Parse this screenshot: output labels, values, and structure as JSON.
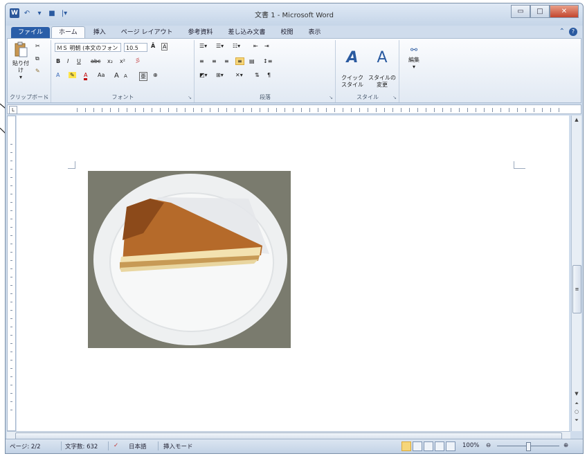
{
  "window": {
    "title": "文書 1 - Microsoft Word",
    "controls": {
      "minimize": "▭",
      "maximize": "□",
      "close": "✕"
    }
  },
  "quick_access": {
    "undo": "↶",
    "redo": "▾",
    "save": "■",
    "customize": "|▾"
  },
  "tabs": [
    {
      "label": "ファイル",
      "active": false,
      "file": true
    },
    {
      "label": "ホーム",
      "active": true,
      "file": false
    },
    {
      "label": "挿入",
      "active": false,
      "file": false
    },
    {
      "label": "ページ レイアウト",
      "active": false,
      "file": false
    },
    {
      "label": "参考資料",
      "active": false,
      "file": false
    },
    {
      "label": "差し込み文書",
      "active": false,
      "file": false
    },
    {
      "label": "校閲",
      "active": false,
      "file": false
    },
    {
      "label": "表示",
      "active": false,
      "file": false
    }
  ],
  "ribbon": {
    "clipboard": {
      "label": "クリップボード",
      "paste": "貼り付け"
    },
    "font": {
      "label": "フォント",
      "font_name": "ＭＳ 明朝 (本文のフォン",
      "font_size": "10.5",
      "row2": [
        "B",
        "I",
        "U",
        "abc",
        "x₂",
        "x²"
      ],
      "row3": [
        "A",
        "A",
        "Aa",
        "A",
        "A"
      ]
    },
    "paragraph": {
      "label": "段落"
    },
    "styles": {
      "label": "スタイル",
      "quick": "クイック\nスタイル",
      "change": "スタイルの\n変更"
    },
    "editing": {
      "label": "編集"
    }
  },
  "document": {
    "image_description_name": "cheesecake-photo"
  },
  "status": {
    "page": "ページ: 2/2",
    "words": "文字数: 632",
    "language": "日本語",
    "mode": "挿入モード",
    "zoom": "100%"
  },
  "colors": {
    "file_tab": "#2a5ea8",
    "ribbon_bg": "#fbfcfe",
    "highlight": "#f6d67a"
  }
}
